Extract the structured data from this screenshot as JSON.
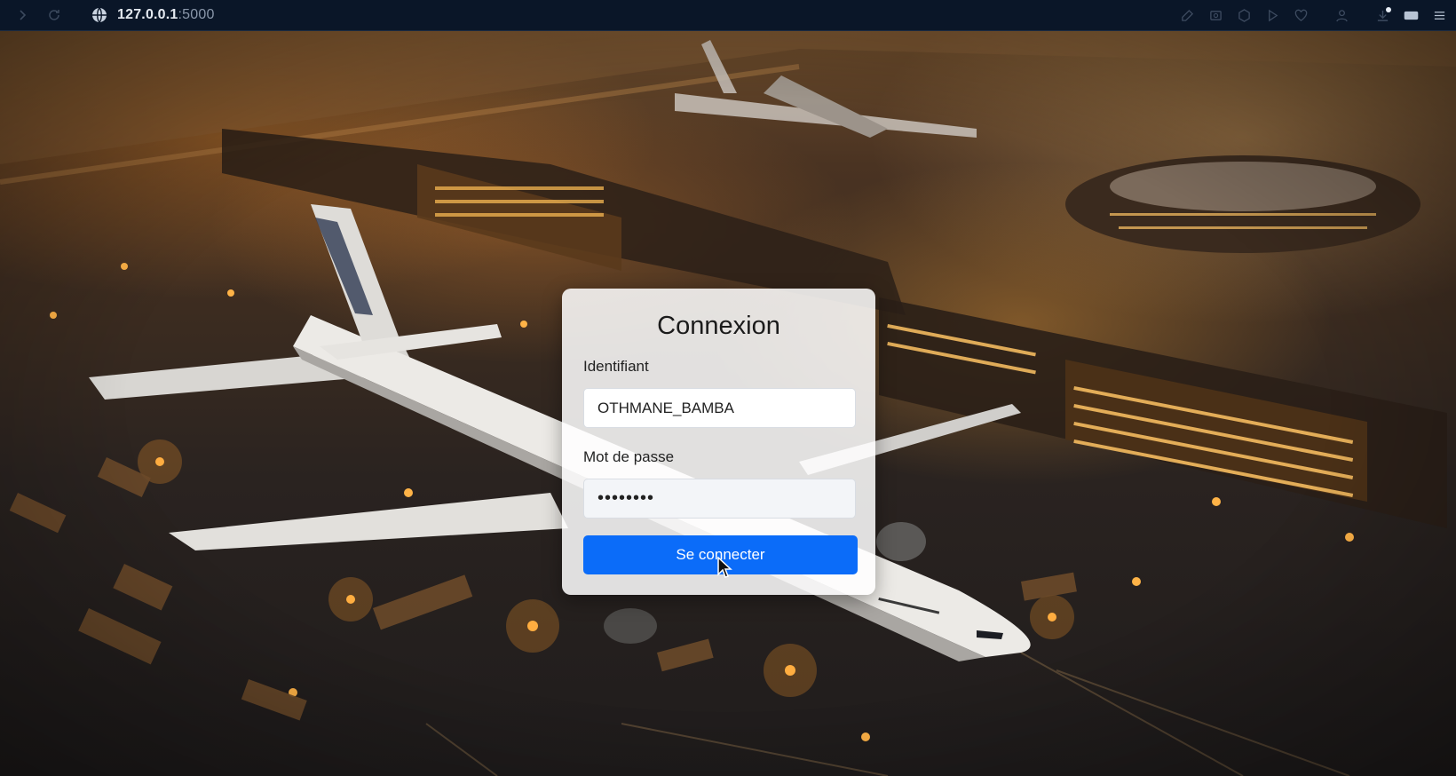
{
  "browser": {
    "url_host": "127.0.0.1",
    "url_port": ":5000",
    "toolbar_icons": [
      "edit-icon",
      "image-icon",
      "extension-icon",
      "play-icon",
      "heart-icon",
      "profile-icon",
      "download-icon",
      "battery-icon",
      "menu-icon"
    ]
  },
  "login": {
    "title": "Connexion",
    "username_label": "Identifiant",
    "username_value": "OTHMANE_BAMBA",
    "password_label": "Mot de passe",
    "password_value": "••••••••",
    "submit_label": "Se connecter"
  },
  "colors": {
    "accent": "#0b6cf9",
    "chrome_bg": "#0a1628"
  }
}
